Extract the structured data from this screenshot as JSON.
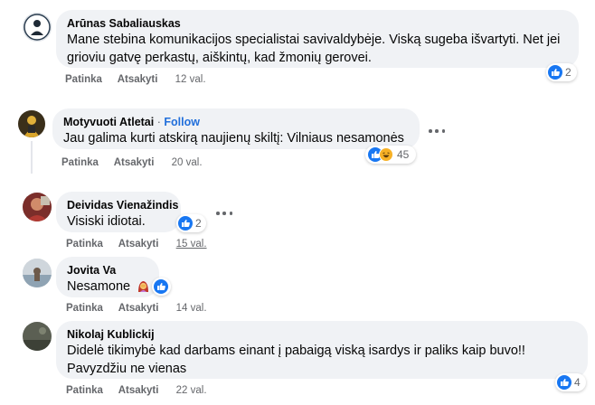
{
  "comments": [
    {
      "author": "Arūnas Sabaliauskas",
      "lines": [
        "Mane stebina komunikacijos specialistai savivaldybėje. Viską sugeba išvartyti. Net jei",
        "grioviu gatvę perkastų, aiškintų, kad žmonių gerovei."
      ],
      "actions": {
        "like": "Patinka",
        "reply": "Atsakyti",
        "time": "12 val."
      },
      "reaction_count": "2",
      "reaction_icons": [
        "like-icon"
      ]
    },
    {
      "author": "Motyvuoti Atletai",
      "separator": "·",
      "follow": "Follow",
      "lines": [
        "Jau galima kurti atskirą naujienų skiltį: Vilniaus nesamonės"
      ],
      "actions": {
        "like": "Patinka",
        "reply": "Atsakyti",
        "time": "20 val."
      },
      "reaction_count": "45",
      "reaction_icons": [
        "like-icon",
        "haha-icon"
      ]
    },
    {
      "author": "Deividas Vienažindis",
      "lines": [
        "Visiski idiotai."
      ],
      "actions": {
        "like": "Patinka",
        "reply": "Atsakyti",
        "time": "15 val."
      },
      "reaction_count": "2",
      "reaction_icons": [
        "like-icon"
      ]
    },
    {
      "author": "Jovita Va",
      "lines": [
        "Nesamone"
      ],
      "actions": {
        "like": "Patinka",
        "reply": "Atsakyti",
        "time": "14 val."
      },
      "reaction_count": "",
      "reaction_icons": [
        "like-icon"
      ],
      "inline_emoji": "woman-facepalming-emoji"
    },
    {
      "author": "Nikolaj Kublickij",
      "lines": [
        "Didelė tikimybė kad darbams einant į pabaigą viską isardys ir paliks kaip buvo!!",
        "Pavyzdžiu ne vienas"
      ],
      "actions": {
        "like": "Patinka",
        "reply": "Atsakyti",
        "time": "22 val."
      },
      "reaction_count": "4",
      "reaction_icons": [
        "like-icon"
      ]
    }
  ],
  "colors": {
    "bubble": "#f0f2f5",
    "like_blue": "#1877f2",
    "follow_blue": "#216fdb",
    "muted": "#65676b"
  },
  "icons": [
    "more-options-icon",
    "like-icon",
    "haha-icon",
    "woman-facepalming-emoji"
  ]
}
